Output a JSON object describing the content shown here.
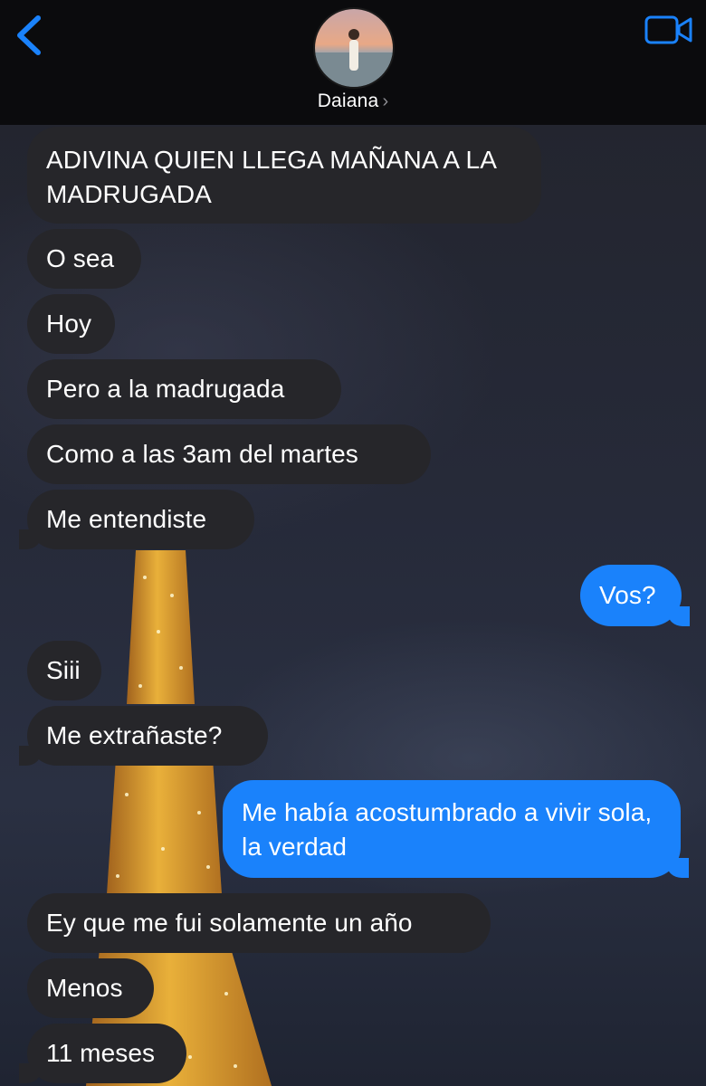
{
  "header": {
    "back_icon": "chevron-left-icon",
    "contact_name": "Daiana",
    "contact_chevron": "›",
    "video_icon": "video-camera-icon",
    "accent_color": "#1a82fb"
  },
  "messages": [
    {
      "side": "received",
      "text": "ADIVINA QUIEN LLEGA MAÑANA A LA MADRUGADA"
    },
    {
      "side": "received",
      "text": "O sea"
    },
    {
      "side": "received",
      "text": "Hoy"
    },
    {
      "side": "received",
      "text": "Pero a la madrugada"
    },
    {
      "side": "received",
      "text": "Como a las 3am del martes"
    },
    {
      "side": "received",
      "text": "Me entendiste"
    },
    {
      "side": "sent",
      "text": "Vos?"
    },
    {
      "side": "received",
      "text": "Siii"
    },
    {
      "side": "received",
      "text": "Me extrañaste?"
    },
    {
      "side": "sent",
      "text": "Me había acostumbrado a vivir sola, la verdad"
    },
    {
      "side": "received",
      "text": "Ey que me fui solamente un año"
    },
    {
      "side": "received",
      "text": "Menos"
    },
    {
      "side": "received",
      "text": "11 meses"
    }
  ],
  "colors": {
    "received_bubble": "#26262a",
    "sent_bubble": "#1a82fb",
    "header_bg": "#0b0b0d"
  }
}
